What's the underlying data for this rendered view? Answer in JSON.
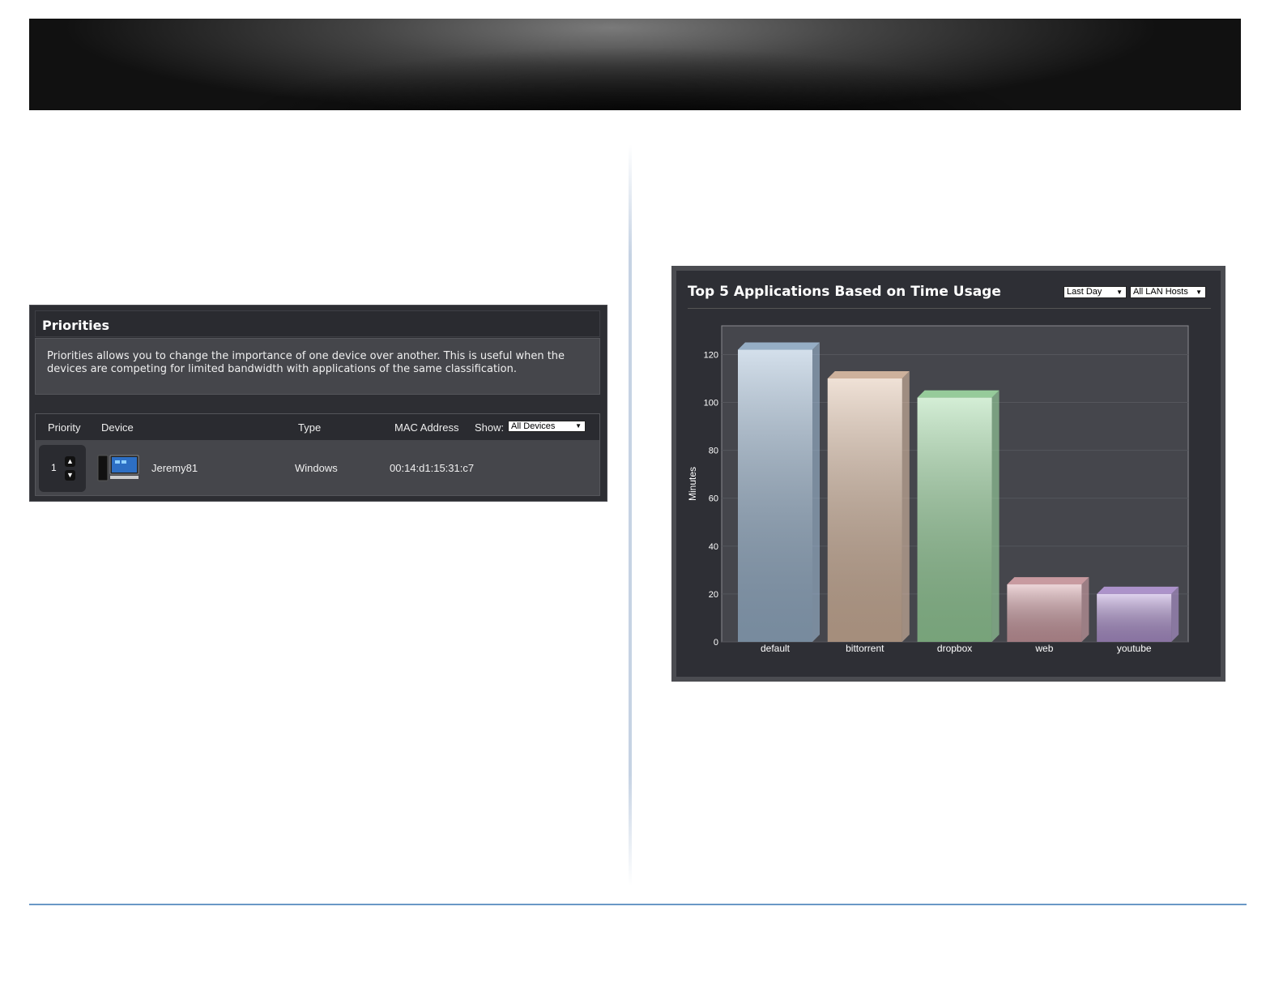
{
  "priorities": {
    "title": "Priorities",
    "description": "Priorities allows you to change the importance of one device over another. This is useful when the devices are competing for limited bandwidth with applications of the same classification.",
    "columns": {
      "priority": "Priority",
      "device": "Device",
      "type": "Type",
      "mac": "MAC Address",
      "show": "Show:"
    },
    "show_value": "All Devices",
    "rows": [
      {
        "priority": "1",
        "device": "Jeremy81",
        "type": "Windows",
        "mac": "00:14:d1:15:31:c7"
      }
    ]
  },
  "chart_panel": {
    "title": "Top 5 Applications Based on Time Usage",
    "period_value": "Last Day",
    "hosts_value": "All LAN Hosts"
  },
  "chart_data": {
    "type": "bar",
    "categories": [
      "default",
      "bittorrent",
      "dropbox",
      "web",
      "youtube"
    ],
    "values": [
      122,
      110,
      102,
      24,
      20
    ],
    "ylabel": "Minutes",
    "ylim": [
      0,
      132
    ],
    "yticks": [
      "0",
      "20",
      "40",
      "60",
      "80",
      "100",
      "120"
    ],
    "grid": true,
    "colors": [
      "#9fb9d3",
      "#dcbda5",
      "#9fd9a3",
      "#d6a3aa",
      "#b79ad8"
    ]
  }
}
